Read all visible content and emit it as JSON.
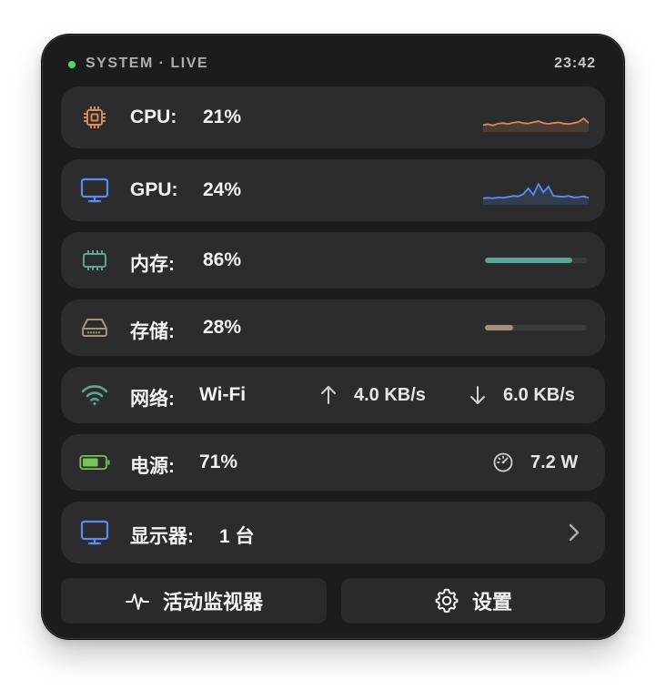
{
  "header": {
    "title": "SYSTEM · LIVE",
    "time": "23:42",
    "live_color": "#4cd964"
  },
  "cpu": {
    "label": "CPU:",
    "value": "21%",
    "icon": "cpu-chip-icon",
    "color": "#d9895a",
    "history": [
      0.22,
      0.25,
      0.2,
      0.28,
      0.3,
      0.26,
      0.32,
      0.35,
      0.3,
      0.28,
      0.34,
      0.38,
      0.3,
      0.27,
      0.3,
      0.33,
      0.28,
      0.26,
      0.3,
      0.35,
      0.5,
      0.3
    ]
  },
  "gpu": {
    "label": "GPU:",
    "value": "24%",
    "icon": "display-icon",
    "color": "#5b8cf0",
    "history": [
      0.2,
      0.22,
      0.2,
      0.24,
      0.22,
      0.26,
      0.3,
      0.28,
      0.38,
      0.62,
      0.35,
      0.8,
      0.45,
      0.7,
      0.3,
      0.28,
      0.26,
      0.3,
      0.24,
      0.25,
      0.28,
      0.22
    ]
  },
  "memory": {
    "label": "内存:",
    "value": "86%",
    "icon": "memory-module-icon",
    "color": "#5aa597",
    "level": 0.86
  },
  "storage": {
    "label": "存储:",
    "value": "28%",
    "icon": "disk-drive-icon",
    "color": "#a39273",
    "level": 0.28
  },
  "network": {
    "label": "网络:",
    "value": "Wi-Fi",
    "icon": "wifi-icon",
    "color": "#5aa597",
    "upload": "4.0 KB/s",
    "download": "6.0 KB/s"
  },
  "power": {
    "label": "电源:",
    "value": "71%",
    "icon": "battery-icon",
    "color": "#78c257",
    "level": 0.71,
    "wattage": "7.2 W",
    "gauge_icon": "gauge-icon"
  },
  "display": {
    "label": "显示器:",
    "value": "1 台",
    "icon": "display-icon",
    "color": "#5b8cf0"
  },
  "buttons": {
    "activity_label": "活动监视器",
    "activity_icon": "activity-pulse-icon",
    "settings_label": "设置",
    "settings_icon": "gear-icon"
  }
}
